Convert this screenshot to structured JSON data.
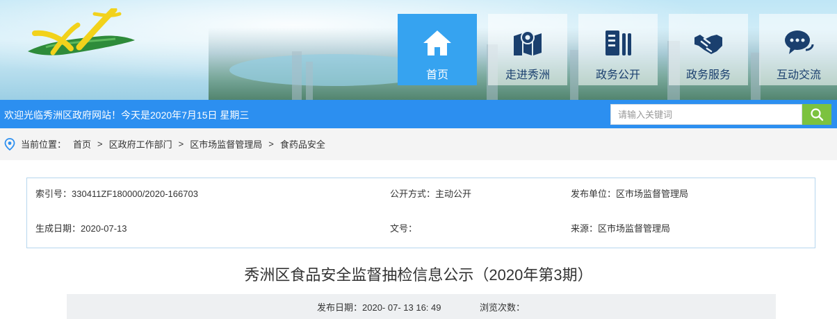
{
  "header": {
    "nav": [
      {
        "label": "首页",
        "icon": "home-icon",
        "active": true
      },
      {
        "label": "走进秀洲",
        "icon": "map-icon",
        "active": false
      },
      {
        "label": "政务公开",
        "icon": "document-icon",
        "active": false
      },
      {
        "label": "政务服务",
        "icon": "handshake-icon",
        "active": false
      },
      {
        "label": "互动交流",
        "icon": "chat-icon",
        "active": false
      }
    ]
  },
  "bar": {
    "welcome": "欢迎光临秀洲区政府网站！今天是2020年7月15日 星期三",
    "search_placeholder": "请输入关键词"
  },
  "breadcrumb": {
    "label": "当前位置：",
    "items": [
      "首页",
      "区政府工作部门",
      "区市场监督管理局",
      "食药品安全"
    ]
  },
  "meta": {
    "index_label": "索引号：",
    "index_value": "330411ZF180000/2020-166703",
    "open_label": "公开方式：",
    "open_value": "主动公开",
    "unit_label": "发布单位：",
    "unit_value": "区市场监督管理局",
    "date_label": "生成日期：",
    "date_value": "2020-07-13",
    "docno_label": "文号：",
    "docno_value": "",
    "source_label": "来源：",
    "source_value": "区市场监督管理局"
  },
  "article": {
    "title": "秀洲区食品安全监督抽检信息公示（2020年第3期）",
    "pub_label": "发布日期：",
    "pub_value": "2020- 07- 13 16: 49",
    "views_label": "浏览次数："
  },
  "colors": {
    "accent": "#2c8ff0",
    "nav_active": "#36a3f0",
    "search_button": "#7cc23f"
  }
}
